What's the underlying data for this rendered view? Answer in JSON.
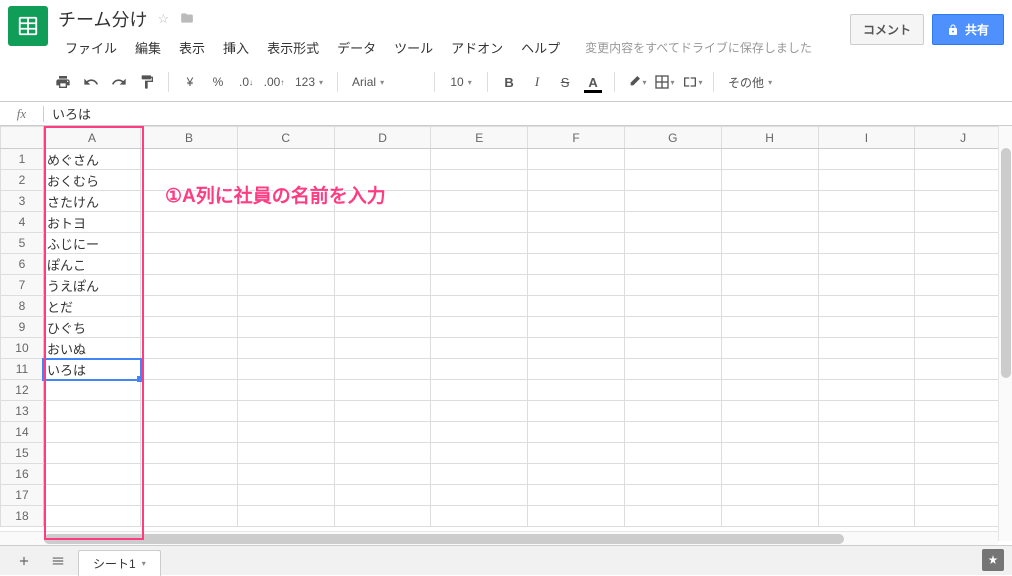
{
  "doc": {
    "title": "チーム分け"
  },
  "menus": {
    "file": "ファイル",
    "edit": "編集",
    "view": "表示",
    "insert": "挿入",
    "format": "表示形式",
    "data": "データ",
    "tools": "ツール",
    "addons": "アドオン",
    "help": "ヘルプ"
  },
  "status": "変更内容をすべてドライブに保存しました",
  "buttons": {
    "comment": "コメント",
    "share": "共有"
  },
  "toolbar": {
    "currency": "¥",
    "percent": "%",
    "dec_dec": ".0",
    "inc_dec": ".00",
    "num_format": "123",
    "font": "Arial",
    "size": "10",
    "bold": "B",
    "italic": "I",
    "strike": "S",
    "textcolor": "A",
    "more": "その他"
  },
  "formula": {
    "fx": "fx",
    "value": "いろは"
  },
  "columns": [
    "A",
    "B",
    "C",
    "D",
    "E",
    "F",
    "G",
    "H",
    "I",
    "J"
  ],
  "rows": [
    "1",
    "2",
    "3",
    "4",
    "5",
    "6",
    "7",
    "8",
    "9",
    "10",
    "11",
    "12",
    "13",
    "14",
    "15",
    "16",
    "17",
    "18"
  ],
  "cells": {
    "A1": "めぐさん",
    "A2": "おくむら",
    "A3": "さたけん",
    "A4": "おトヨ",
    "A5": "ふじにー",
    "A6": "ぽんこ",
    "A7": "うえぽん",
    "A8": "とだ",
    "A9": "ひぐち",
    "A10": "おいぬ",
    "A11": "いろは"
  },
  "selected_cell": "A11",
  "annotation": "①A列に社員の名前を入力",
  "sheet": {
    "tab1": "シート1"
  }
}
